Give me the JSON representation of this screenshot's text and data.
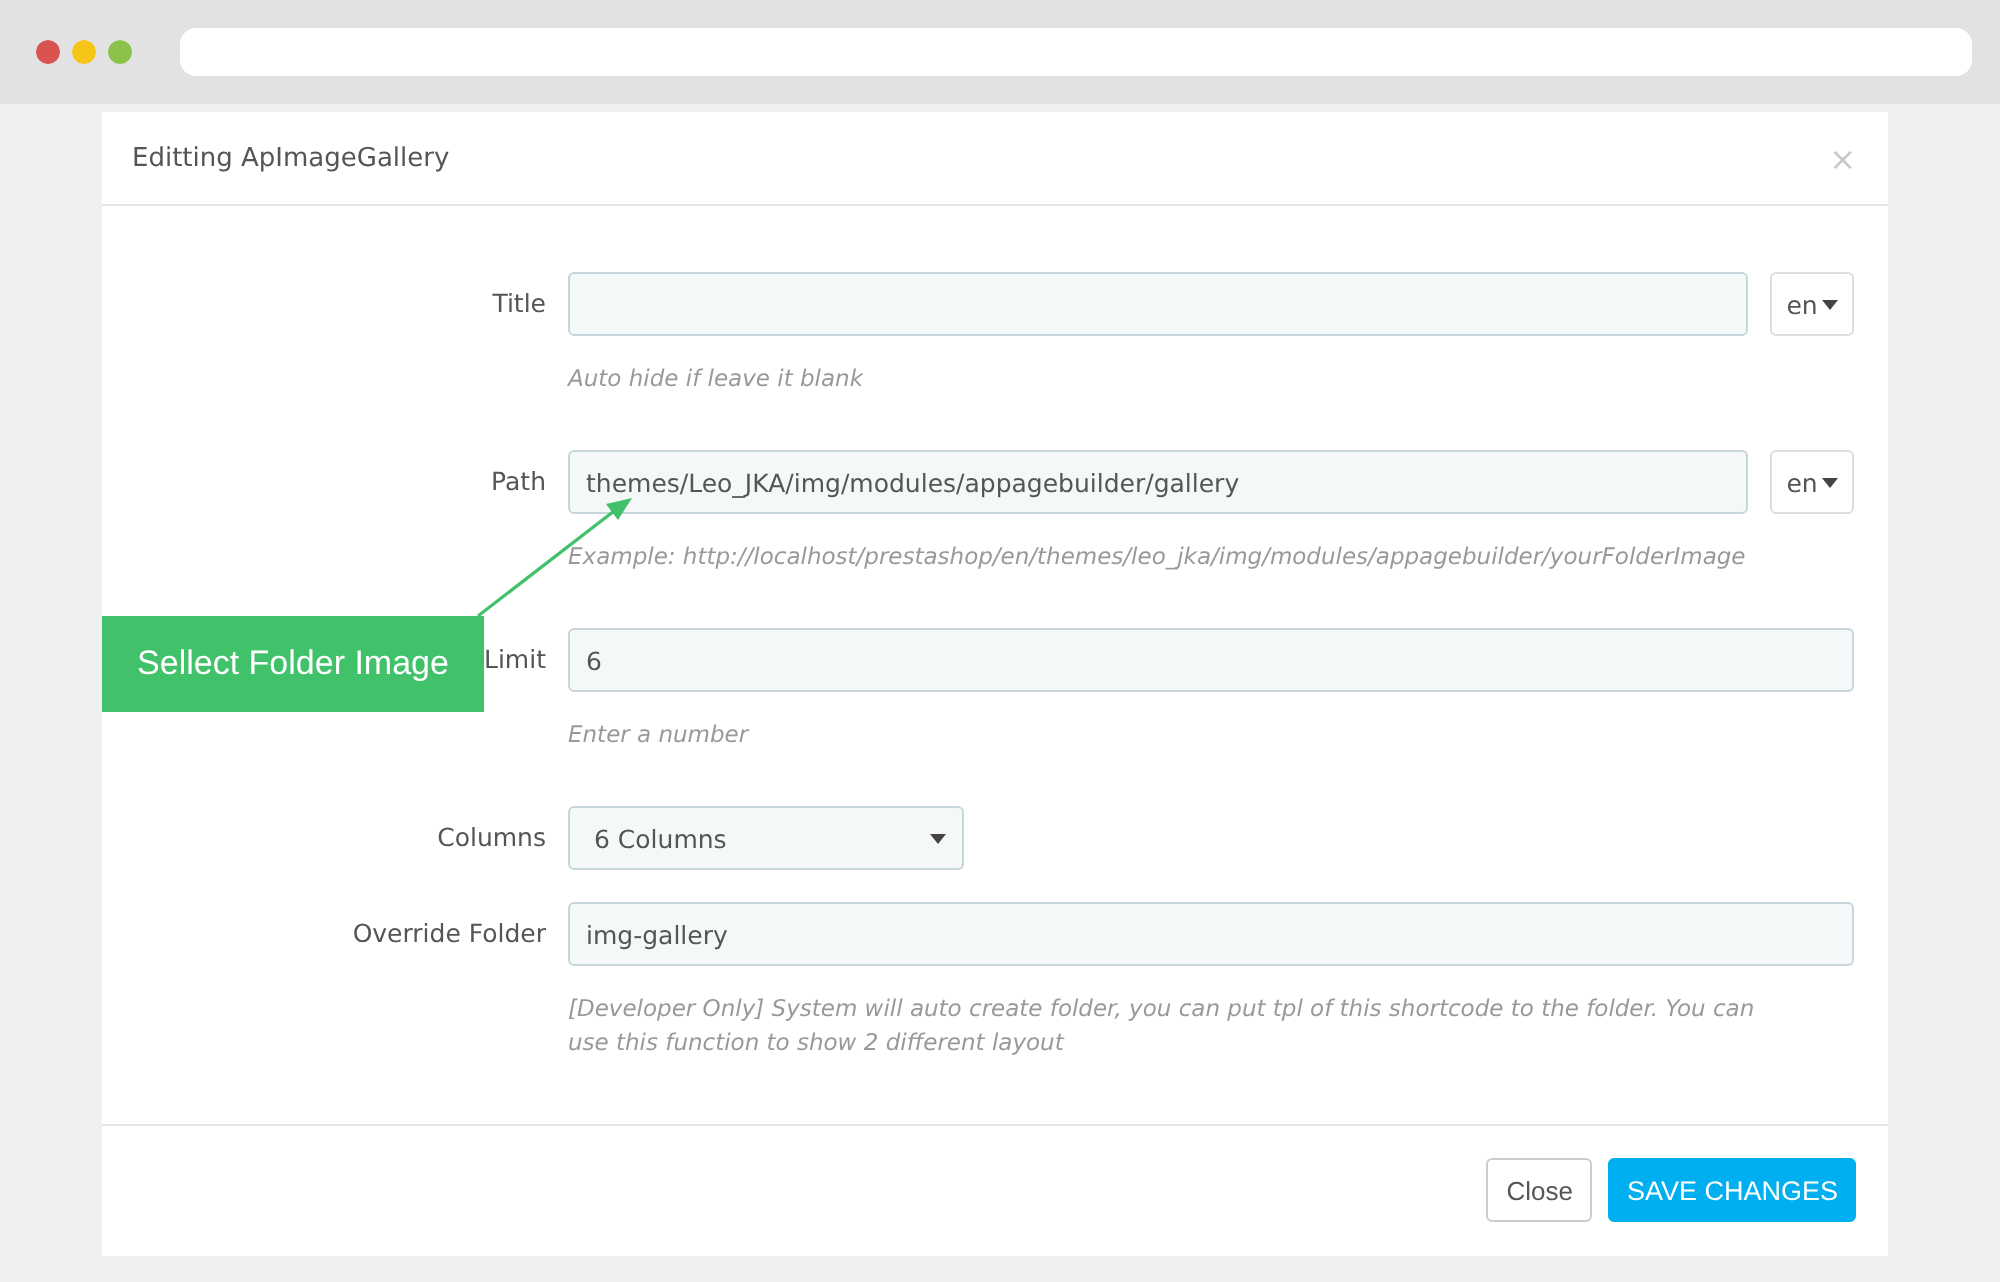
{
  "dialog": {
    "title": "Editting ApImageGallery",
    "close": "×"
  },
  "fields": [
    {
      "kind": "text",
      "label": "Title",
      "lang": "en",
      "help": "Auto hide if leave it blank"
    },
    {
      "kind": "text",
      "label": "Path",
      "value": "themes/Leo_JKA/img/modules/appagebuilder/gallery",
      "lang": "en",
      "help": "Example: http://localhost/prestashop/en/themes/leo_jka/img/modules/appagebuilder/yourFolderImage"
    },
    {
      "kind": "text",
      "label": "Limit",
      "value": "6",
      "help": "Enter a number"
    },
    {
      "kind": "select",
      "label": "Columns",
      "value": "6 Columns"
    },
    {
      "kind": "text",
      "label": "Override Folder",
      "value": "img-gallery",
      "help": "[Developer Only] System will auto create folder, you can put tpl of this shortcode to the folder. You can use this function to show 2 different layout"
    }
  ],
  "callout": {
    "text": "Sellect Folder Image"
  },
  "buttons": [
    {
      "label": "Close",
      "kind": "default"
    },
    {
      "label": "SAVE CHANGES",
      "kind": "primary"
    }
  ]
}
